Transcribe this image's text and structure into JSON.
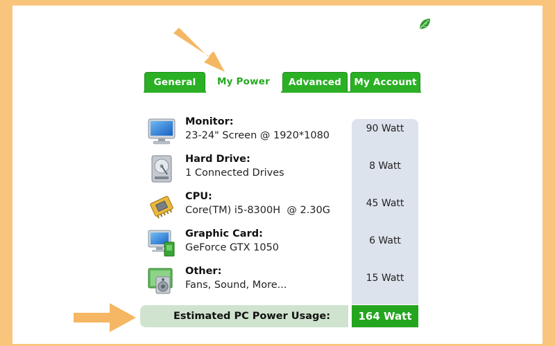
{
  "tabs": [
    {
      "label": "General",
      "active": false
    },
    {
      "label": "My Power",
      "active": true
    },
    {
      "label": "Advanced",
      "active": false
    },
    {
      "label": "My Account",
      "active": false
    }
  ],
  "components": [
    {
      "title": "Monitor:",
      "desc": "23-24\" Screen @ 1920*1080",
      "watt": "90 Watt",
      "icon": "monitor-icon"
    },
    {
      "title": "Hard Drive:",
      "desc": "1 Connected Drives",
      "watt": "8 Watt",
      "icon": "hard-drive-icon"
    },
    {
      "title": "CPU:",
      "desc": "Core(TM) i5-8300H  @ 2.30G",
      "watt": "45 Watt",
      "icon": "cpu-chip-icon"
    },
    {
      "title": "Graphic Card:",
      "desc": "GeForce GTX 1050",
      "watt": "6 Watt",
      "icon": "graphic-card-icon"
    },
    {
      "title": "Other:",
      "desc": "Fans, Sound, More...",
      "watt": "15 Watt",
      "icon": "speaker-icon"
    }
  ],
  "total": {
    "label": "Estimated PC Power Usage:",
    "value": "164 Watt"
  },
  "colors": {
    "accent_green": "#2bb025",
    "background": "#f9c47c",
    "watt_column": "#dde3ec",
    "arrow": "#f5b763"
  }
}
